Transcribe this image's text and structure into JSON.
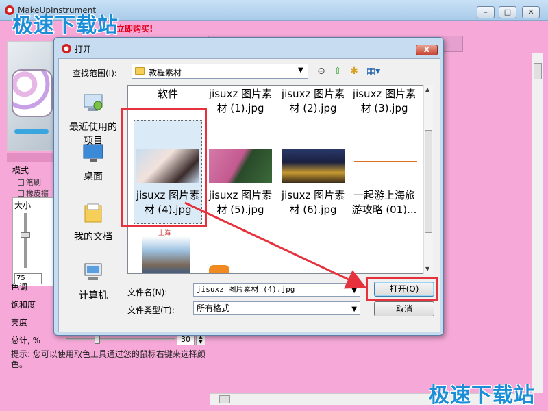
{
  "main_window": {
    "title": "MakeUpInstrument",
    "promo_text": "立即购买!",
    "minimize": "–",
    "maximize": "□",
    "close": "✕"
  },
  "watermark": {
    "top": "极速下载站",
    "bottom": "极速下载站"
  },
  "tool_panel": {
    "mode_label": "模式",
    "brush_label": "笔刷",
    "eraser_label": "橡皮擦",
    "size_label": "大小",
    "size_value": "75",
    "hue_label": "色调",
    "saturation_label": "饱和度",
    "brightness_label": "亮度",
    "total_label": "总计, %",
    "total_value": "30",
    "hint": "提示: 您可以使用取色工具通过您的鼠标右键来选择颜色。"
  },
  "dialog": {
    "title": "打开",
    "close": "X",
    "look_in_label": "查找范围(I):",
    "look_in_value": "教程素材",
    "places": [
      {
        "label": "最近使用的项目"
      },
      {
        "label": "桌面"
      },
      {
        "label": "我的文档"
      },
      {
        "label": "计算机"
      }
    ],
    "files": [
      {
        "name": "软件"
      },
      {
        "name": "jisuxz 图片素材 (1).jpg"
      },
      {
        "name": "jisuxz 图片素材 (2).jpg"
      },
      {
        "name": "jisuxz 图片素材 (3).jpg"
      },
      {
        "name": "jisuxz 图片素材 (4).jpg"
      },
      {
        "name": "jisuxz 图片素材 (5).jpg"
      },
      {
        "name": "jisuxz 图片素材 (6).jpg"
      },
      {
        "name": "一起游上海旅游攻略 (01)..."
      }
    ],
    "thumb_text_shanghai": "上海",
    "filename_label": "文件名(N):",
    "filename_value": "jisuxz 图片素材 (4).jpg",
    "filetype_label": "文件类型(T):",
    "filetype_value": "所有格式",
    "open_button": "打开(O)",
    "cancel_button": "取消"
  },
  "colors": {
    "background_pink": "#f6a9d8",
    "highlight_red": "#e5323c",
    "watermark_blue": "#1a8fd8"
  }
}
